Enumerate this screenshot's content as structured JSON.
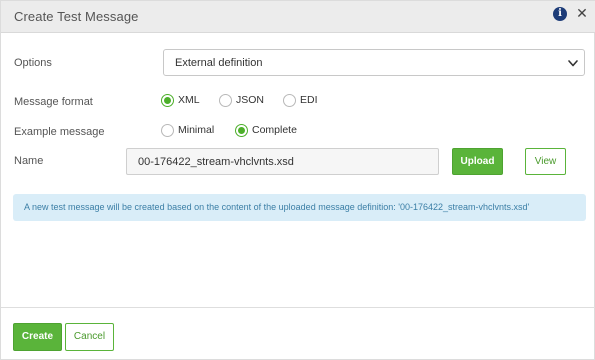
{
  "dialog": {
    "title": "Create Test Message",
    "info_icon": "info-circle-icon",
    "close_icon": "close-icon",
    "close_glyph": "✕",
    "info_glyph": "i"
  },
  "form": {
    "options": {
      "label": "Options",
      "value": "External definition"
    },
    "message_format": {
      "label": "Message format",
      "options": [
        {
          "label": "XML",
          "checked": true
        },
        {
          "label": "JSON",
          "checked": false
        },
        {
          "label": "EDI",
          "checked": false
        }
      ]
    },
    "example_message": {
      "label": "Example message",
      "options": [
        {
          "label": "Minimal",
          "checked": false
        },
        {
          "label": "Complete",
          "checked": true
        }
      ]
    },
    "name": {
      "label": "Name",
      "value": "00-176422_stream-vhclvnts.xsd"
    },
    "upload_label": "Upload",
    "view_label": "View"
  },
  "info_banner": {
    "text": "A new test message will be created based on the content of the uploaded message definition: '00-176422_stream-vhclvnts.xsd'"
  },
  "footer": {
    "create_label": "Create",
    "cancel_label": "Cancel"
  },
  "colors": {
    "accent_green": "#5ab43a",
    "info_bg": "#d9edf8",
    "info_text": "#3c7fa6",
    "header_bg": "#ececec"
  }
}
